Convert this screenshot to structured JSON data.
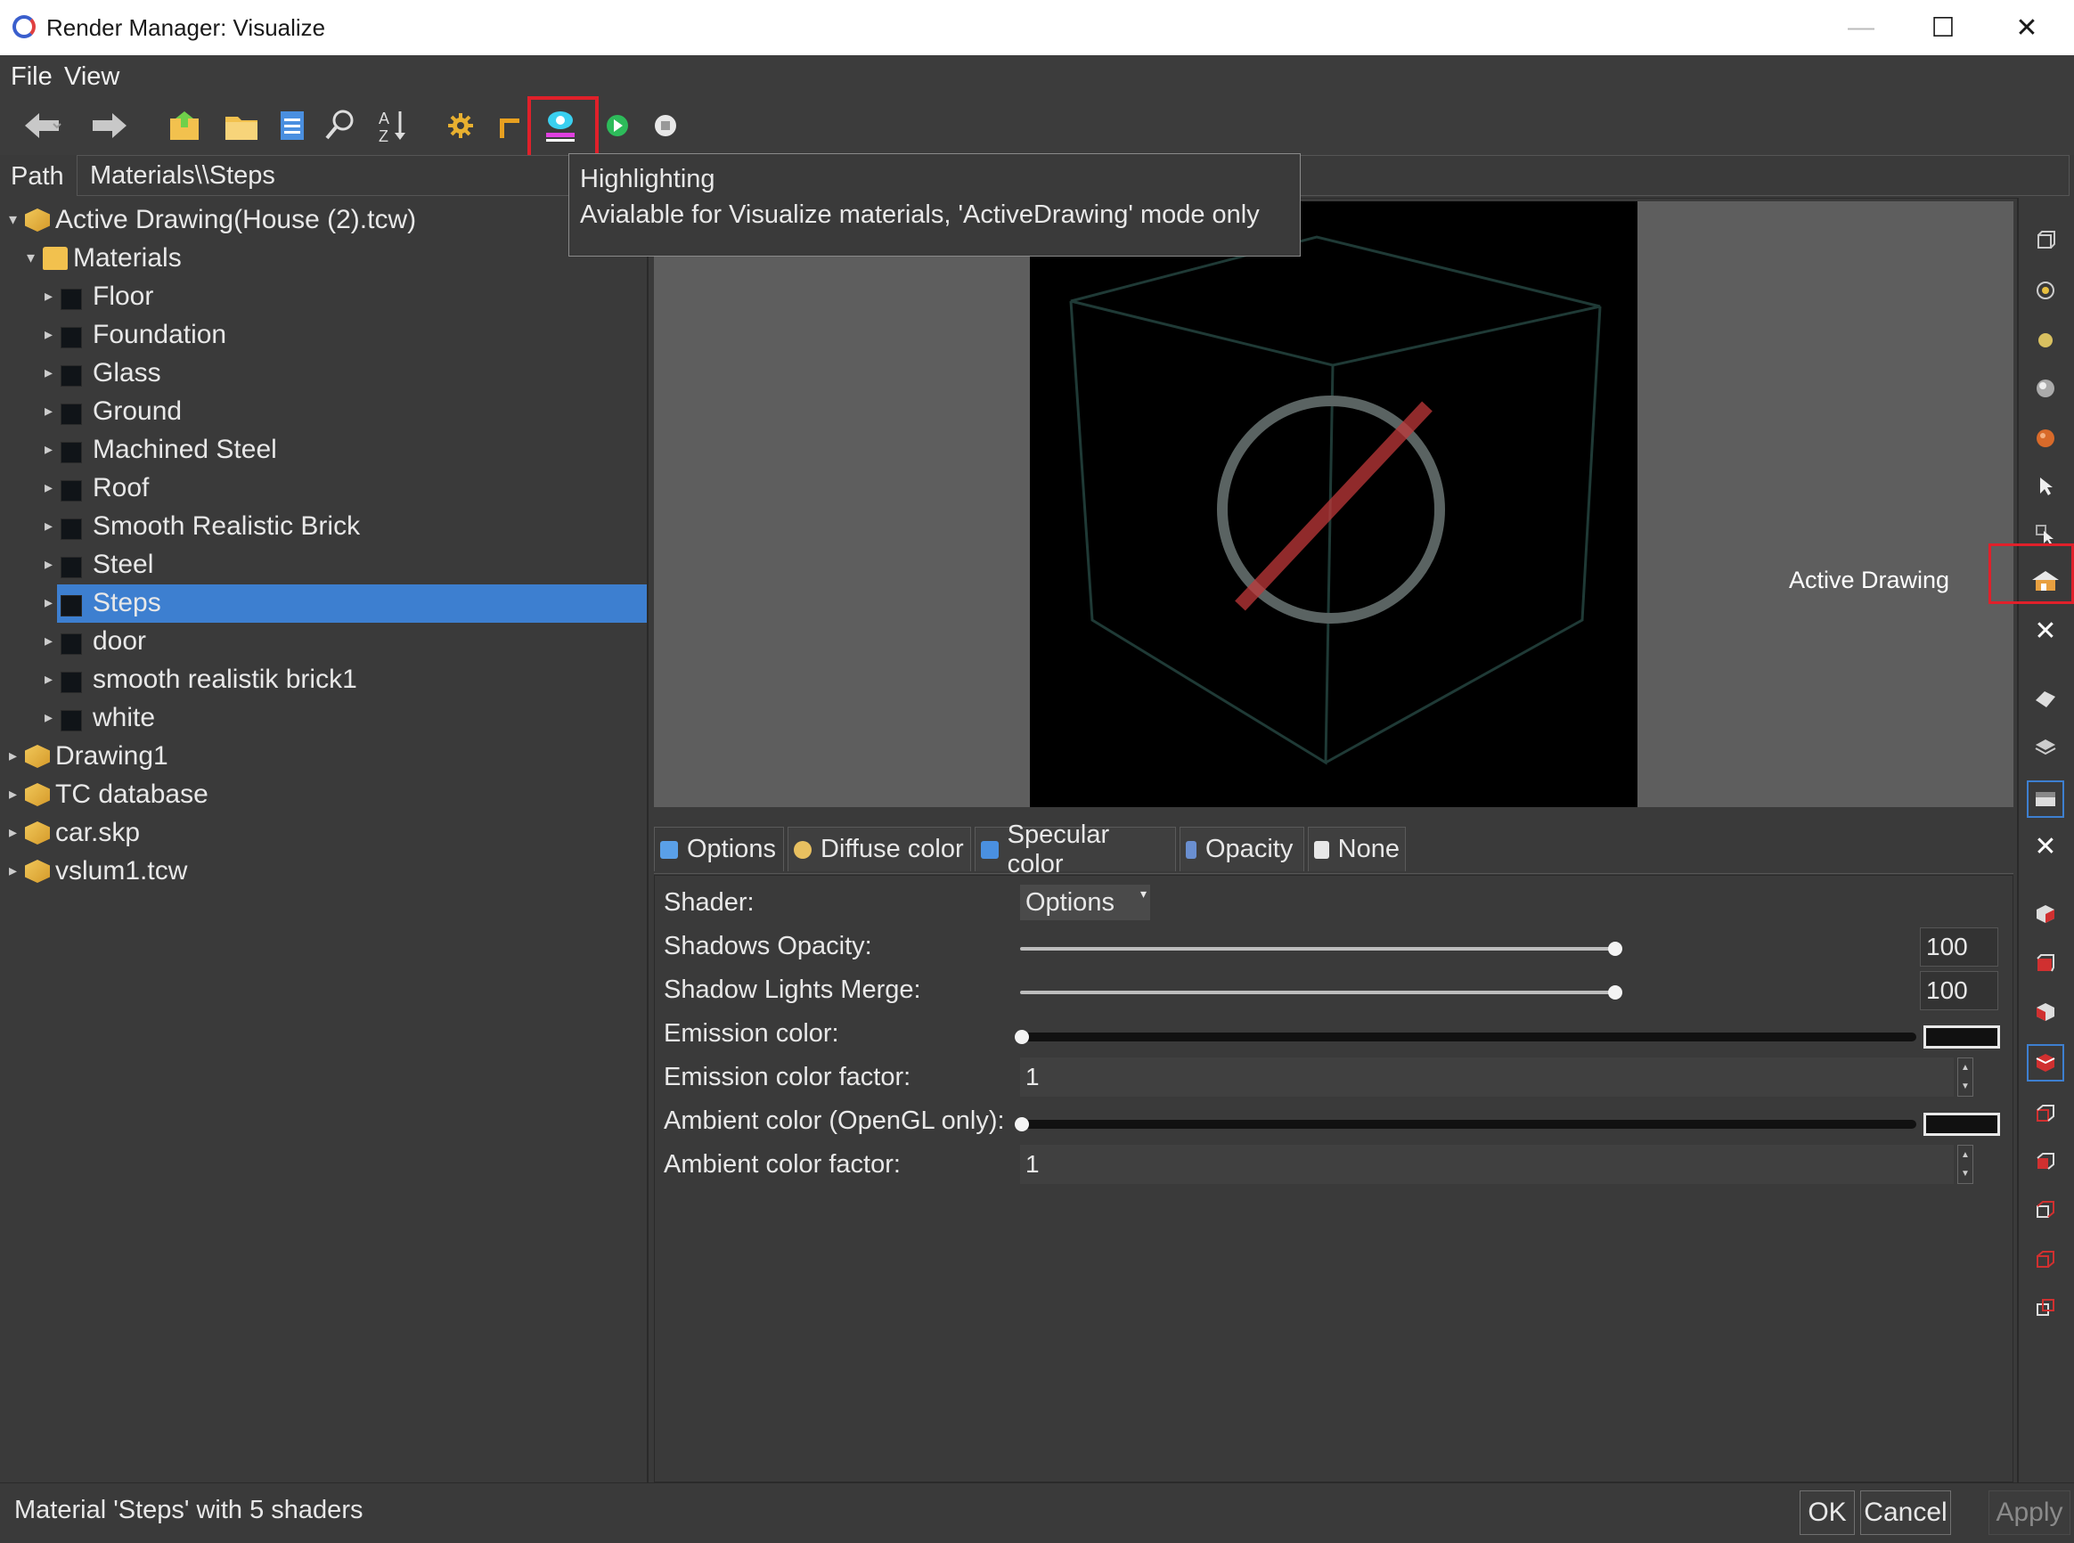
{
  "window": {
    "title": "Render Manager: Visualize",
    "minimize": "—",
    "maximize": "☐",
    "close": "✕"
  },
  "menu": [
    "File",
    "View"
  ],
  "toolbar": {
    "icons": [
      "back-arrow-icon",
      "forward-arrow-icon",
      "open-folder-icon",
      "folder-icon",
      "document-icon",
      "search-icon",
      "sort-az-icon",
      "gear-icon",
      "corner-icon",
      "highlighting-icon",
      "play-icon",
      "stop-icon"
    ]
  },
  "path": {
    "label": "Path",
    "value": "Materials\\\\Steps"
  },
  "tree": [
    {
      "label": "Active Drawing(House (2).tcw)",
      "level": 0,
      "icon": "cube"
    },
    {
      "label": "Materials",
      "level": 1,
      "icon": "folder"
    },
    {
      "label": "Floor",
      "level": 2,
      "icon": "material"
    },
    {
      "label": "Foundation",
      "level": 2,
      "icon": "material"
    },
    {
      "label": "Glass",
      "level": 2,
      "icon": "material"
    },
    {
      "label": "Ground",
      "level": 2,
      "icon": "material"
    },
    {
      "label": "Machined Steel",
      "level": 2,
      "icon": "material"
    },
    {
      "label": "Roof",
      "level": 2,
      "icon": "material"
    },
    {
      "label": "Smooth Realistic Brick",
      "level": 2,
      "icon": "material"
    },
    {
      "label": "Steel",
      "level": 2,
      "icon": "material"
    },
    {
      "label": "Steps",
      "level": 2,
      "icon": "material",
      "selected": true
    },
    {
      "label": "door",
      "level": 2,
      "icon": "material"
    },
    {
      "label": "smooth realistik brick1",
      "level": 2,
      "icon": "material"
    },
    {
      "label": "white",
      "level": 2,
      "icon": "material"
    },
    {
      "label": "Drawing1",
      "level": 0,
      "icon": "cube"
    },
    {
      "label": "TC database",
      "level": 0,
      "icon": "cube"
    },
    {
      "label": "car.skp",
      "level": 0,
      "icon": "cube"
    },
    {
      "label": "vslum1.tcw",
      "level": 0,
      "icon": "cube"
    }
  ],
  "tooltip": {
    "title": "Highlighting",
    "text": "Avialable for Visualize materials, 'ActiveDrawing' mode only"
  },
  "preview": {
    "mode_label": "Active Drawing"
  },
  "tabs": [
    {
      "label": "Options",
      "icon": "options-icon"
    },
    {
      "label": "Diffuse color",
      "icon": "diffuse-icon"
    },
    {
      "label": "Specular color",
      "icon": "specular-icon"
    },
    {
      "label": "Opacity",
      "icon": "opacity-icon"
    },
    {
      "label": "None",
      "icon": "none-icon"
    }
  ],
  "options": {
    "shader_label": "Shader:",
    "shader_value": "Options",
    "shadows_opacity_label": "Shadows Opacity:",
    "shadows_opacity_value": "100",
    "shadow_lights_merge_label": "Shadow Lights Merge:",
    "shadow_lights_merge_value": "100",
    "emission_color_label": "Emission color:",
    "emission_factor_label": "Emission color factor:",
    "emission_factor_value": "1",
    "ambient_color_label": "Ambient color (OpenGL only):",
    "ambient_factor_label": "Ambient color factor:",
    "ambient_factor_value": "1"
  },
  "status": {
    "text": "Material 'Steps' with 5 shaders",
    "ok": "OK",
    "cancel": "Cancel",
    "apply": "Apply"
  },
  "colors": {
    "accent": "#3d7fd0",
    "highlight_box": "#e0202a",
    "background": "#3a3a3a"
  }
}
